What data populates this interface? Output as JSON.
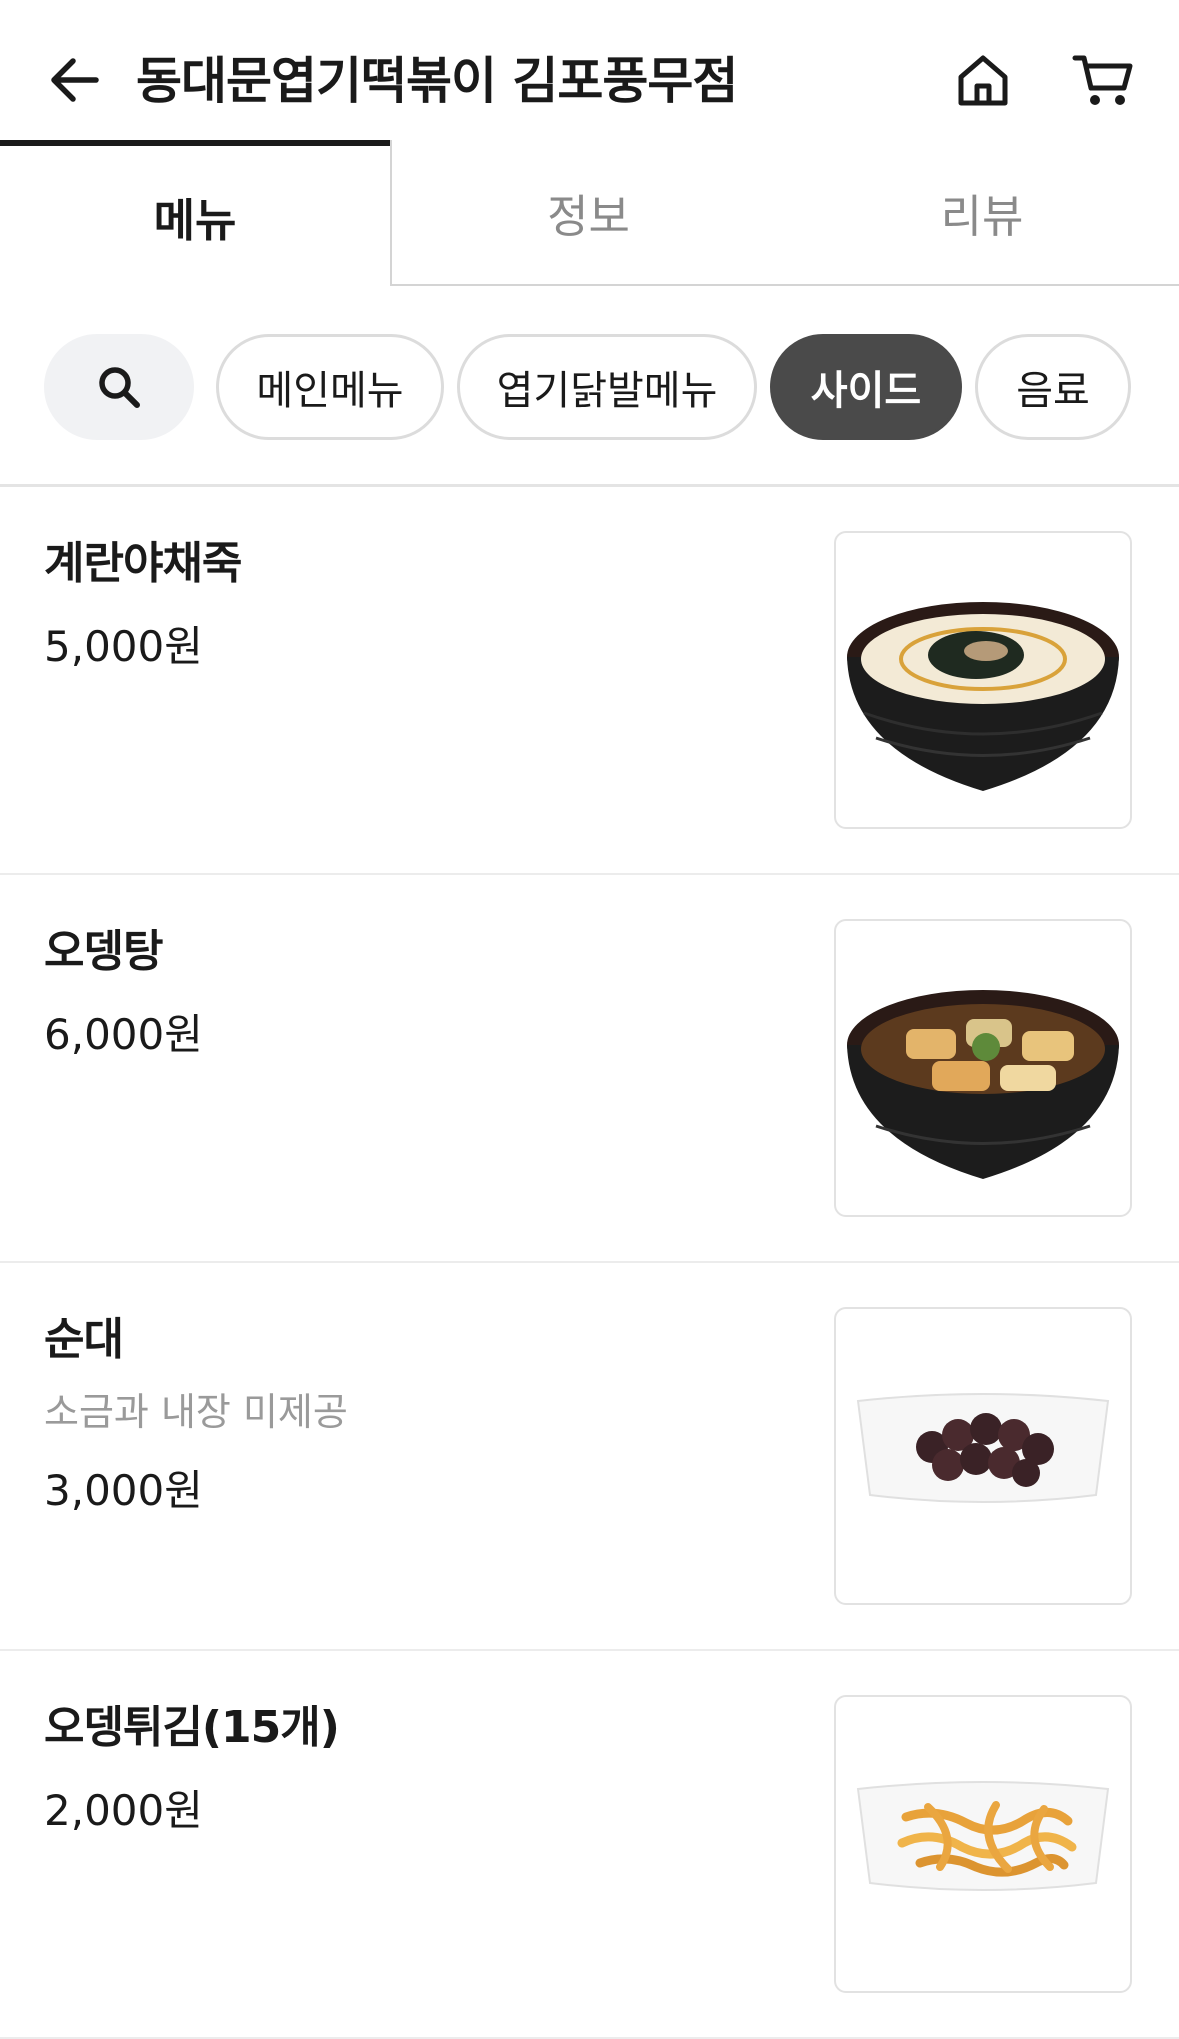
{
  "header": {
    "title": "동대문엽기떡볶이 김포풍무점",
    "back_icon": "arrow-left-icon",
    "home_icon": "home-icon",
    "cart_icon": "cart-icon"
  },
  "tabs": [
    {
      "label": "메뉴",
      "active": true
    },
    {
      "label": "정보",
      "active": false
    },
    {
      "label": "리뷰",
      "active": false
    }
  ],
  "categories": {
    "search_icon": "search-icon",
    "items": [
      {
        "label": "메인메뉴",
        "active": false
      },
      {
        "label": "엽기닭발메뉴",
        "active": false
      },
      {
        "label": "사이드",
        "active": true
      },
      {
        "label": "음료",
        "active": false
      }
    ]
  },
  "menu": [
    {
      "name": "계란야채죽",
      "description": "",
      "price": "5,000원",
      "image": "egg-porridge-bowl"
    },
    {
      "name": "오뎅탕",
      "description": "",
      "price": "6,000원",
      "image": "fishcake-soup-bowl"
    },
    {
      "name": "순대",
      "description": "소금과 내장 미제공",
      "price": "3,000원",
      "image": "sundae-plate"
    },
    {
      "name": "오뎅튀김(15개)",
      "description": "",
      "price": "2,000원",
      "image": "fried-fishcake-plate"
    }
  ],
  "colors": {
    "active_chip_bg": "#4a4a4a",
    "inactive_tab_text": "#8a8a8a",
    "description_text": "#9a9a9a"
  }
}
